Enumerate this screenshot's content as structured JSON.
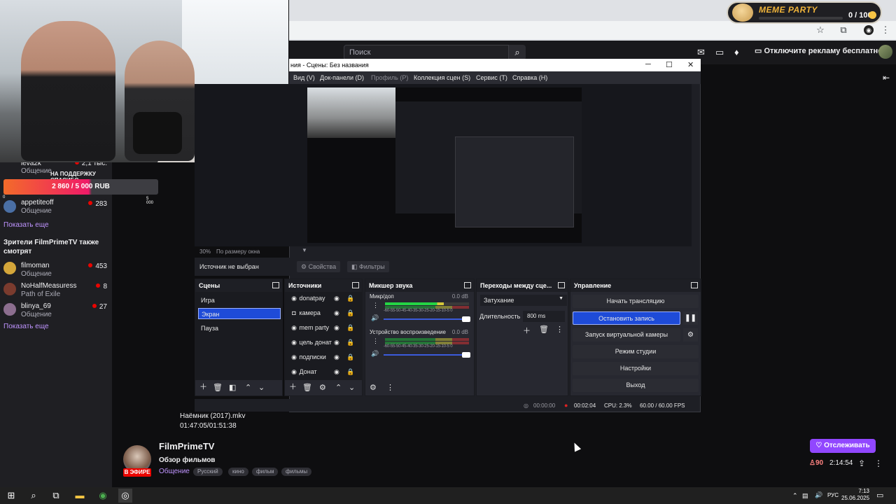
{
  "meme_party": {
    "title": "MEME PARTY",
    "counter": "0 / 100"
  },
  "twitch": {
    "search_placeholder": "Поиск",
    "ad_free": "Отключите рекламу бесплатно"
  },
  "sidebar": {
    "top_user": "leva2k",
    "top_user_sub": "Общение",
    "top_user_viewers": "2,1 тыс.",
    "donation": {
      "caption": "НА ПОДДЕРЖКУ СПАСИБО",
      "progress": "2 860 / 5 000 RUB",
      "min": "0",
      "max": "5 000",
      "fraction": 0.572
    },
    "followed": [
      {
        "name": "appetiteoff",
        "sub": "Общение",
        "viewers": "283"
      }
    ],
    "show_more_1": "Показать еще",
    "also_watch_header": "Зрители FilmPrimeTV также смотрят",
    "also_watch": [
      {
        "name": "filmoman",
        "sub": "Общение",
        "viewers": "453"
      },
      {
        "name": "NoHalfMeasuress",
        "sub": "Path of Exile",
        "viewers": "8"
      },
      {
        "name": "blinya_69",
        "sub": "Общение",
        "viewers": "27"
      }
    ],
    "show_more_2": "Показать еще"
  },
  "obs": {
    "title": "ния - Сцены: Без названия",
    "menu": [
      {
        "label": "Вид (V)",
        "dim": false
      },
      {
        "label": "Док-панели (D)",
        "dim": false
      },
      {
        "label": "Профиль (P)",
        "dim": true
      },
      {
        "label": "Коллекция сцен (S)",
        "dim": false
      },
      {
        "label": "Сервис (T)",
        "dim": false
      },
      {
        "label": "Справка (H)",
        "dim": false
      }
    ],
    "zoom": "30%",
    "zoom_mode": "По размеру окна",
    "no_source": "Источник не выбран",
    "properties": "Свойства",
    "filters": "Фильтры",
    "scenes_title": "Сцены",
    "scenes": [
      "Игра",
      "Экран",
      "Пауза"
    ],
    "selected_scene": "Экран",
    "sources_title": "Источники",
    "sources": [
      "donatpay",
      "камера",
      "mem party",
      "цель донат",
      "подписки",
      "Донат"
    ],
    "mixer_title": "Микшер звука",
    "mixer": [
      {
        "name": "Микр/доп",
        "db": "0.0 dB"
      },
      {
        "name": "Устройство воспроизведение",
        "db": "0.0 dB"
      }
    ],
    "meter_scale": "-60-55-50-45-40-35-30-25-20-15-10-5 0",
    "transitions_title": "Переходы между сце...",
    "transition": "Затухание",
    "duration_label": "Длительность",
    "duration_value": "800 ms",
    "controls_title": "Управление",
    "controls": {
      "start_stream": "Начать трансляцию",
      "stop_record": "Остановить запись",
      "virtual_cam": "Запуск виртуальной камеры",
      "studio_mode": "Режим студии",
      "settings": "Настройки",
      "exit": "Выход"
    },
    "status": {
      "stream_time": "00:00:00",
      "rec_time": "00:02:04",
      "cpu": "CPU: 2.3%",
      "fps": "60.00 / 60.00 FPS"
    }
  },
  "film": {
    "title": "Наёмник (2017).mkv",
    "time": "01:47:05/01:51:38"
  },
  "channel": {
    "name": "FilmPrimeTV",
    "live": "В ЭФИРЕ",
    "stream_title": "Обзор фильмов",
    "category": "Общение",
    "tags": [
      "Русский",
      "кино",
      "фильм",
      "фильмы"
    ],
    "follow": "Отслеживать",
    "viewers": "90",
    "uptime": "2:14:54"
  },
  "taskbar": {
    "lang": "РУС",
    "time": "7:13",
    "date": "25.06.2025"
  }
}
